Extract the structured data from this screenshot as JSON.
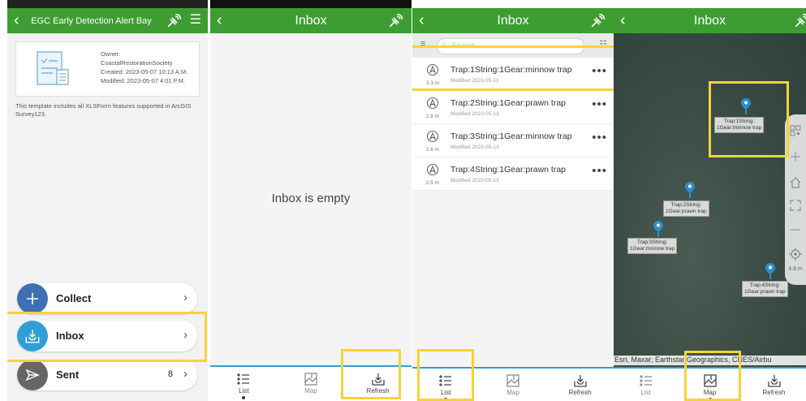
{
  "panel1": {
    "title": "EGC Early Detection Alert Bay",
    "owner_label": "Owner:",
    "owner": "CoastalRestorationSociety",
    "created": "Created: 2023-05-07 10:13 A.M.",
    "modified": "Modified: 2023-05-07 4:01 P.M.",
    "description": "This template includes all XLSForm features supported in ArcGIS Survey123.",
    "menu": [
      {
        "label": "Collect",
        "color": "#3f70b5",
        "icon": "plus-icon"
      },
      {
        "label": "Inbox",
        "color": "#2f9fd6",
        "icon": "inbox-icon"
      },
      {
        "label": "Sent",
        "color": "#666666",
        "icon": "paper-plane-icon",
        "count": "8"
      }
    ]
  },
  "panel2": {
    "title": "Inbox",
    "empty_message": "Inbox is empty"
  },
  "panel3": {
    "title": "Inbox",
    "search_placeholder": "Search",
    "items": [
      {
        "title": "Trap:1String:1Gear:minnow trap",
        "sub": "Modified 2023-05-13",
        "dist": "3.3 m"
      },
      {
        "title": "Trap:2String:1Gear:prawn trap",
        "sub": "Modified 2023-05-13",
        "dist": "2.8 m"
      },
      {
        "title": "Trap:3String:1Gear:minnow trap",
        "sub": "Modified 2023-05-13",
        "dist": "2.6 m"
      },
      {
        "title": "Trap:4String:1Gear:prawn trap",
        "sub": "Modified 2023-05-13",
        "dist": "2.5 m"
      }
    ]
  },
  "panel4": {
    "title": "Inbox",
    "pins": [
      {
        "line1": "Trap:1String:",
        "line2": "1Gear:minnow trap"
      },
      {
        "line1": "Trap:2String:",
        "line2": "1Gear:prawn trap"
      },
      {
        "line1": "Trap:3String:",
        "line2": "1Gear:minnow trap"
      },
      {
        "line1": "Trap:4String:",
        "line2": "1Gear:prawn trap"
      }
    ],
    "zoom_distance": "4.8 m",
    "attribution": "Esri, Maxar, Earthstar Geographics, CNES/Airbu"
  },
  "tabs": {
    "list": "List",
    "map": "Map",
    "refresh": "Refresh"
  },
  "colors": {
    "topbar": "#3d9d32",
    "accent": "#2f9fd6",
    "highlight": "#f6d435",
    "pin": "#2a8fd0"
  }
}
